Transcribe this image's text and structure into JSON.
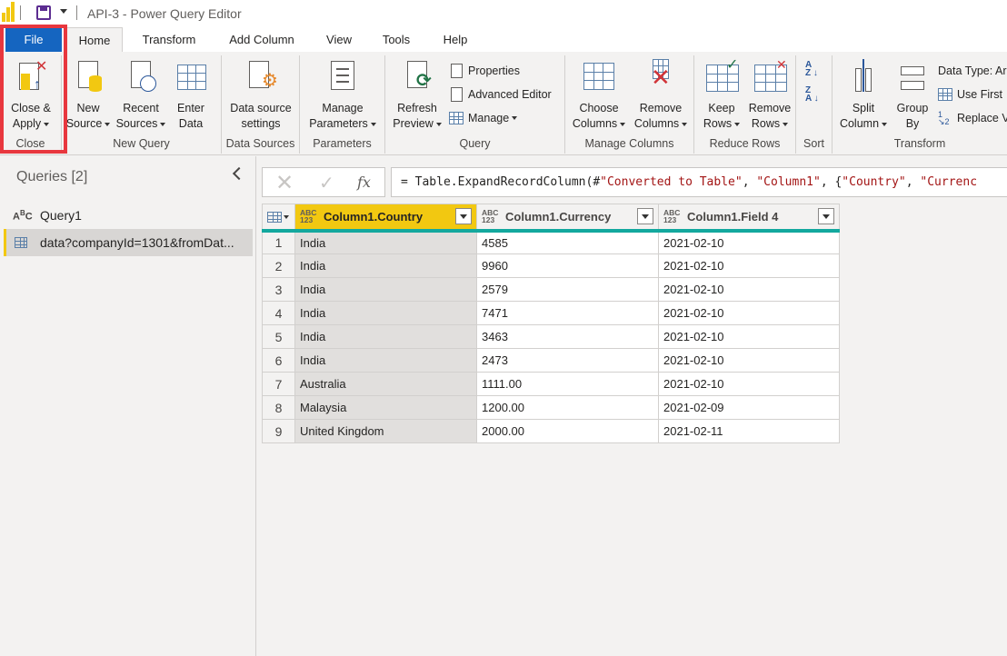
{
  "window": {
    "title": "API-3 - Power Query Editor"
  },
  "menu": {
    "tabs": [
      "File",
      "Home",
      "Transform",
      "Add Column",
      "View",
      "Tools",
      "Help"
    ]
  },
  "ribbon": {
    "close": {
      "btn_line1": "Close &",
      "btn_line2": "Apply",
      "label": "Close"
    },
    "new_query": {
      "new_line1": "New",
      "new_line2": "Source",
      "recent_line1": "Recent",
      "recent_line2": "Sources",
      "enter_line1": "Enter",
      "enter_line2": "Data",
      "label": "New Query"
    },
    "data_sources": {
      "btn_line1": "Data source",
      "btn_line2": "settings",
      "label": "Data Sources"
    },
    "parameters": {
      "btn_line1": "Manage",
      "btn_line2": "Parameters",
      "label": "Parameters"
    },
    "query": {
      "refresh_line1": "Refresh",
      "refresh_line2": "Preview",
      "properties": "Properties",
      "advanced_editor": "Advanced Editor",
      "manage": "Manage",
      "label": "Query"
    },
    "manage_columns": {
      "choose_line1": "Choose",
      "choose_line2": "Columns",
      "remove_line1": "Remove",
      "remove_line2": "Columns",
      "label": "Manage Columns"
    },
    "reduce_rows": {
      "keep_line1": "Keep",
      "keep_line2": "Rows",
      "remove_line1": "Remove",
      "remove_line2": "Rows",
      "label": "Reduce Rows"
    },
    "sort": {
      "label": "Sort"
    },
    "transform": {
      "split_line1": "Split",
      "split_line2": "Column",
      "group_line1": "Group",
      "group_line2": "By",
      "data_type": "Data Type: Ar",
      "use_first": "Use First",
      "replace": "Replace V",
      "label": "Transform"
    }
  },
  "queries": {
    "title": "Queries [2]",
    "items": [
      {
        "label": "Query1"
      },
      {
        "label": "data?companyId=1301&fromDat..."
      }
    ]
  },
  "formula": {
    "prefix": "= Table.ExpandRecordColumn(#",
    "str1": "\"Converted to Table\"",
    "sep1": ", ",
    "str2": "\"Column1\"",
    "sep2": ", {",
    "str3": "\"Country\"",
    "sep3": ", ",
    "str4": "\"Currenc"
  },
  "grid": {
    "type_label_top": "ABC",
    "type_label_bottom": "123",
    "columns": [
      "Column1.Country",
      "Column1.Currency",
      "Column1.Field 4"
    ],
    "rows": [
      {
        "n": "1",
        "country": "India",
        "currency": "4585",
        "field4": "2021-02-10"
      },
      {
        "n": "2",
        "country": "India",
        "currency": "9960",
        "field4": "2021-02-10"
      },
      {
        "n": "3",
        "country": "India",
        "currency": "2579",
        "field4": "2021-02-10"
      },
      {
        "n": "4",
        "country": "India",
        "currency": "7471",
        "field4": "2021-02-10"
      },
      {
        "n": "5",
        "country": "India",
        "currency": "3463",
        "field4": "2021-02-10"
      },
      {
        "n": "6",
        "country": "India",
        "currency": "2473",
        "field4": "2021-02-10"
      },
      {
        "n": "7",
        "country": "Australia",
        "currency": "1111.00",
        "field4": "2021-02-10"
      },
      {
        "n": "8",
        "country": "Malaysia",
        "currency": "1200.00",
        "field4": "2021-02-09"
      },
      {
        "n": "9",
        "country": "United Kingdom",
        "currency": "2000.00",
        "field4": "2021-02-11"
      }
    ]
  },
  "colors": {
    "accent_yellow": "#f2c811",
    "file_tab": "#1565c0",
    "highlight": "#e8373e",
    "header_bar": "#13a89e"
  }
}
